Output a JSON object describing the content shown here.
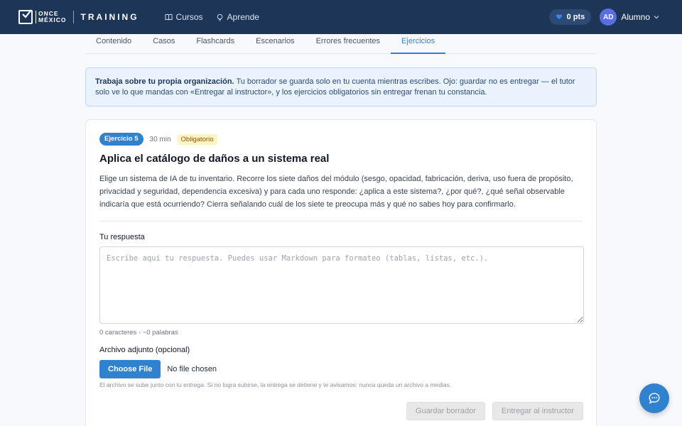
{
  "header": {
    "logo_line1": "ONCE",
    "logo_line2": "MÉXICO",
    "logo_product": "TRAINING",
    "nav": [
      {
        "label": "Cursos",
        "icon": "book-icon"
      },
      {
        "label": "Aprende",
        "icon": "lightbulb-icon"
      }
    ],
    "points": "0 pts",
    "user_initials": "AD",
    "user_name": "Alumno"
  },
  "tabs": [
    {
      "label": "Contenido",
      "active": false
    },
    {
      "label": "Casos",
      "active": false
    },
    {
      "label": "Flashcards",
      "active": false
    },
    {
      "label": "Escenarios",
      "active": false
    },
    {
      "label": "Errores frecuentes",
      "active": false
    },
    {
      "label": "Ejercicios",
      "active": true
    }
  ],
  "notice": {
    "bold": "Trabaja sobre tu propia organización.",
    "text": " Tu borrador se guarda solo en tu cuenta mientras escribes. Ojo: guardar no es entregar — el tutor solo ve lo que mandas con «Entregar al instructor», y los ejercicios obligatorios sin entregar frenan tu constancia."
  },
  "exercise": {
    "badge": "Ejercicio 5",
    "time": "30 min",
    "required": "Obligatorio",
    "title": "Aplica el catálogo de daños a un sistema real",
    "body": "Elige un sistema de IA de tu inventario. Recorre los siete daños del módulo (sesgo, opacidad, fabricación, deriva, uso fuera de propósito, privacidad y seguridad, dependencia excesiva) y para cada uno responde: ¿aplica a este sistema?, ¿por qué?, ¿qué señal observable indicaría que está ocurriendo? Cierra señalando cuál de los siete te preocupa más y qué no sabes hoy para confirmarlo.",
    "response_label": "Tu respuesta",
    "response_value": "",
    "response_placeholder": "Escribe aquí tu respuesta. Puedes usar Markdown para formateo (tablas, listas, etc.).",
    "count": "0 caracteres · ~0 palabras",
    "file_label": "Archivo adjunto (opcional)",
    "choose_file": "Choose File",
    "no_file": "No file chosen",
    "file_help": "El archivo se sube junto con tu entrega. Si no logra subirse, la entrega se detiene y te avisamos: nunca queda un archivo a medias.",
    "save_draft": "Guardar borrador",
    "submit": "Entregar al instructor"
  },
  "colors": {
    "header_bg": "#1d3557",
    "accent": "#3182ce",
    "required_bg": "#fdf3c4"
  }
}
